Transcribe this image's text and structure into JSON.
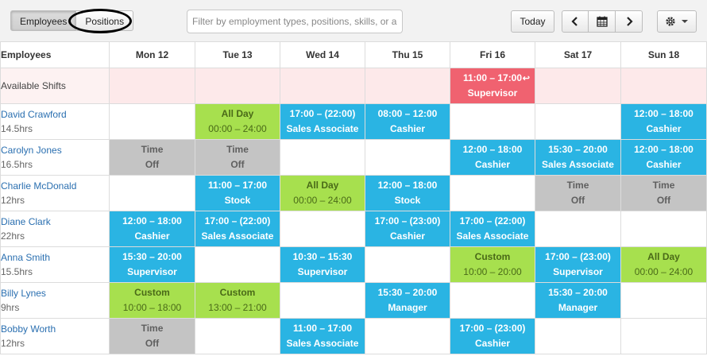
{
  "toolbar": {
    "employees_tab": "Employees",
    "positions_tab": "Positions",
    "filter_placeholder": "Filter by employment types, positions, skills, or an",
    "today_label": "Today",
    "prev_icon": "chevron-left-icon",
    "calendar_icon": "calendar-icon",
    "next_icon": "chevron-right-icon",
    "settings_icon": "gear-icon"
  },
  "grid": {
    "first_col_header": "Employees",
    "days": [
      "Mon 12",
      "Tue 13",
      "Wed 14",
      "Thu 15",
      "Fri 16",
      "Sat 17",
      "Sun 18"
    ],
    "available": {
      "label": "Available Shifts",
      "cells": [
        null,
        null,
        null,
        null,
        {
          "color": "red",
          "line1": "11:00 – 17:00",
          "line2": "Supervisor",
          "icon": "undo-icon"
        },
        null,
        null
      ]
    },
    "employees": [
      {
        "name": "David Crawford",
        "hours": "14.5hrs",
        "cells": [
          null,
          {
            "color": "green",
            "line1": "All Day",
            "line2": "00:00 – 24:00"
          },
          {
            "color": "blue",
            "line1": "17:00 – (22:00)",
            "line2": "Sales Associate"
          },
          {
            "color": "blue",
            "line1": "08:00 – 12:00",
            "line2": "Cashier"
          },
          null,
          null,
          {
            "color": "blue",
            "line1": "12:00 – 18:00",
            "line2": "Cashier"
          }
        ]
      },
      {
        "name": "Carolyn Jones",
        "hours": "16.5hrs",
        "cells": [
          {
            "color": "gray",
            "line1": "Time",
            "line2": "Off"
          },
          {
            "color": "gray",
            "line1": "Time",
            "line2": "Off"
          },
          null,
          null,
          {
            "color": "blue",
            "line1": "12:00 – 18:00",
            "line2": "Cashier"
          },
          {
            "color": "blue",
            "line1": "15:30 – 20:00",
            "line2": "Sales Associate"
          },
          {
            "color": "blue",
            "line1": "12:00 – 18:00",
            "line2": "Cashier"
          }
        ]
      },
      {
        "name": "Charlie McDonald",
        "hours": "12hrs",
        "cells": [
          null,
          {
            "color": "blue",
            "line1": "11:00 – 17:00",
            "line2": "Stock"
          },
          {
            "color": "green",
            "line1": "All Day",
            "line2": "00:00 – 24:00"
          },
          {
            "color": "blue",
            "line1": "12:00 – 18:00",
            "line2": "Stock"
          },
          null,
          {
            "color": "gray",
            "line1": "Time",
            "line2": "Off"
          },
          {
            "color": "gray",
            "line1": "Time",
            "line2": "Off"
          }
        ]
      },
      {
        "name": "Diane Clark",
        "hours": "22hrs",
        "cells": [
          {
            "color": "blue",
            "line1": "12:00 – 18:00",
            "line2": "Cashier"
          },
          {
            "color": "blue",
            "line1": "17:00 – (22:00)",
            "line2": "Sales Associate"
          },
          null,
          {
            "color": "blue",
            "line1": "17:00 – (23:00)",
            "line2": "Cashier"
          },
          {
            "color": "blue",
            "line1": "17:00 – (22:00)",
            "line2": "Sales Associate"
          },
          null,
          null
        ]
      },
      {
        "name": "Anna Smith",
        "hours": "15.5hrs",
        "cells": [
          {
            "color": "blue",
            "line1": "15:30 – 20:00",
            "line2": "Supervisor"
          },
          null,
          {
            "color": "blue",
            "line1": "10:30 – 15:30",
            "line2": "Supervisor"
          },
          null,
          {
            "color": "green",
            "line1": "Custom",
            "line2": "10:00 – 20:00"
          },
          {
            "color": "blue",
            "line1": "17:00 – (23:00)",
            "line2": "Supervisor"
          },
          {
            "color": "green",
            "line1": "All Day",
            "line2": "00:00 – 24:00"
          }
        ]
      },
      {
        "name": "Billy Lynes",
        "hours": "9hrs",
        "cells": [
          {
            "color": "green",
            "line1": "Custom",
            "line2": "10:00 – 18:00"
          },
          {
            "color": "green",
            "line1": "Custom",
            "line2": "13:00 – 21:00"
          },
          null,
          {
            "color": "blue",
            "line1": "15:30 – 20:00",
            "line2": "Manager"
          },
          null,
          {
            "color": "blue",
            "line1": "15:30 – 20:00",
            "line2": "Manager"
          },
          null
        ]
      },
      {
        "name": "Bobby Worth",
        "hours": "12hrs",
        "cells": [
          {
            "color": "gray",
            "line1": "Time",
            "line2": "Off"
          },
          null,
          {
            "color": "blue",
            "line1": "11:00 – 17:00",
            "line2": "Sales Associate"
          },
          null,
          {
            "color": "blue",
            "line1": "17:00 – (23:00)",
            "line2": "Cashier"
          },
          null,
          null
        ]
      }
    ]
  }
}
